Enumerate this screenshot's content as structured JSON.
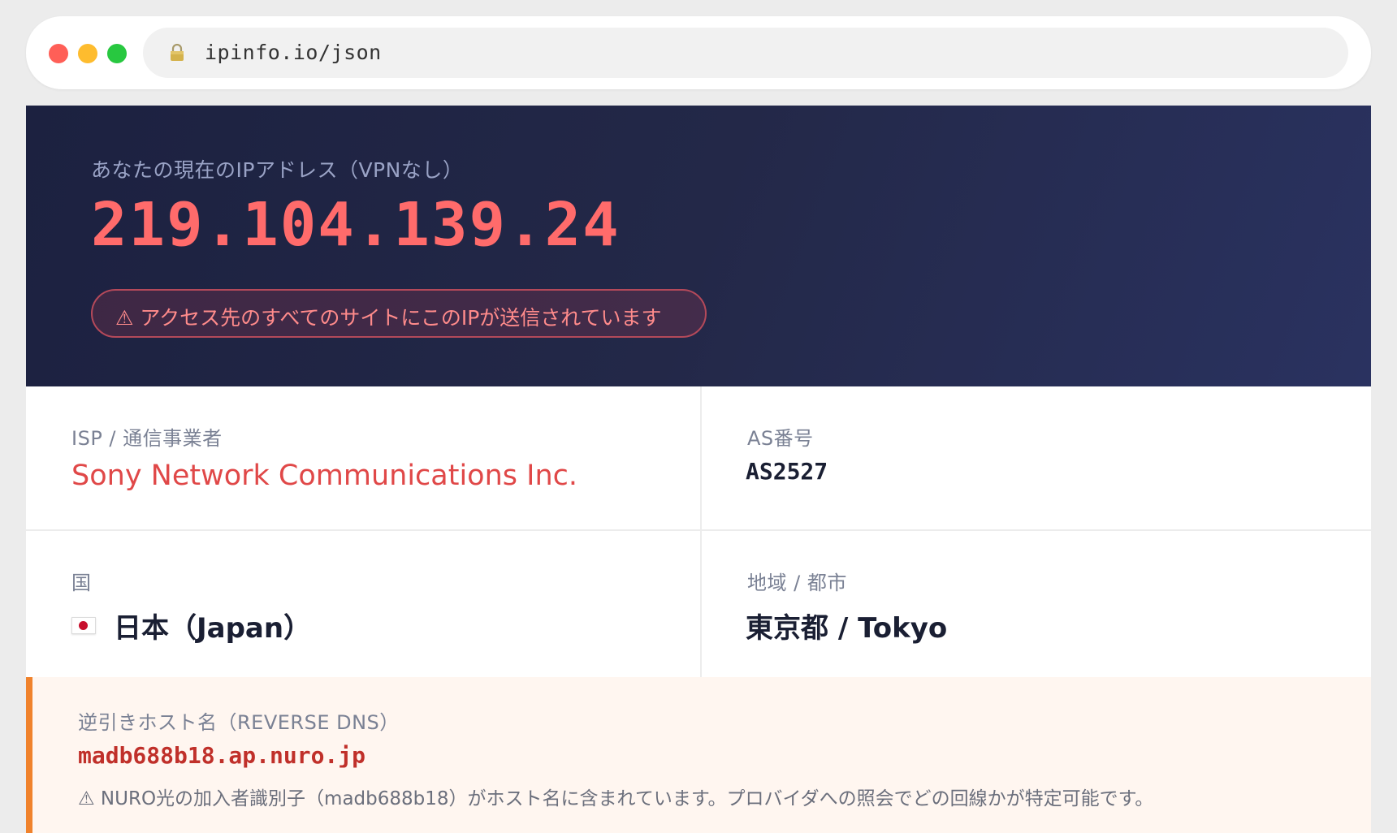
{
  "browser": {
    "url": "ipinfo.io/json"
  },
  "hero": {
    "label": "あなたの現在のIPアドレス（VPNなし）",
    "ip": "219.104.139.24",
    "warning": "⚠ アクセス先のすべてのサイトにこのIPが送信されています"
  },
  "details": {
    "isp": {
      "label": "ISP / 通信事業者",
      "value": "Sony Network Communications Inc."
    },
    "as": {
      "label": "AS番号",
      "value": "AS2527"
    },
    "country": {
      "label": "国",
      "flag": "japan-flag-icon",
      "value": "日本（Japan）"
    },
    "region": {
      "label": "地域 / 都市",
      "value": "東京都 / Tokyo"
    }
  },
  "rdns": {
    "label": "逆引きホスト名（REVERSE DNS）",
    "host": "madb688b18.ap.nuro.jp",
    "note": "⚠ NURO光の加入者識別子（madb688b18）がホスト名に含まれています。プロバイダへの照会でどの回線かが特定可能です。"
  },
  "colors": {
    "hero_bg": "#1c2140",
    "ip_red": "#ff6b6b",
    "isp_red": "#e04848",
    "rdns_accent": "#f0822c",
    "rdns_bg": "#fff6f0"
  }
}
